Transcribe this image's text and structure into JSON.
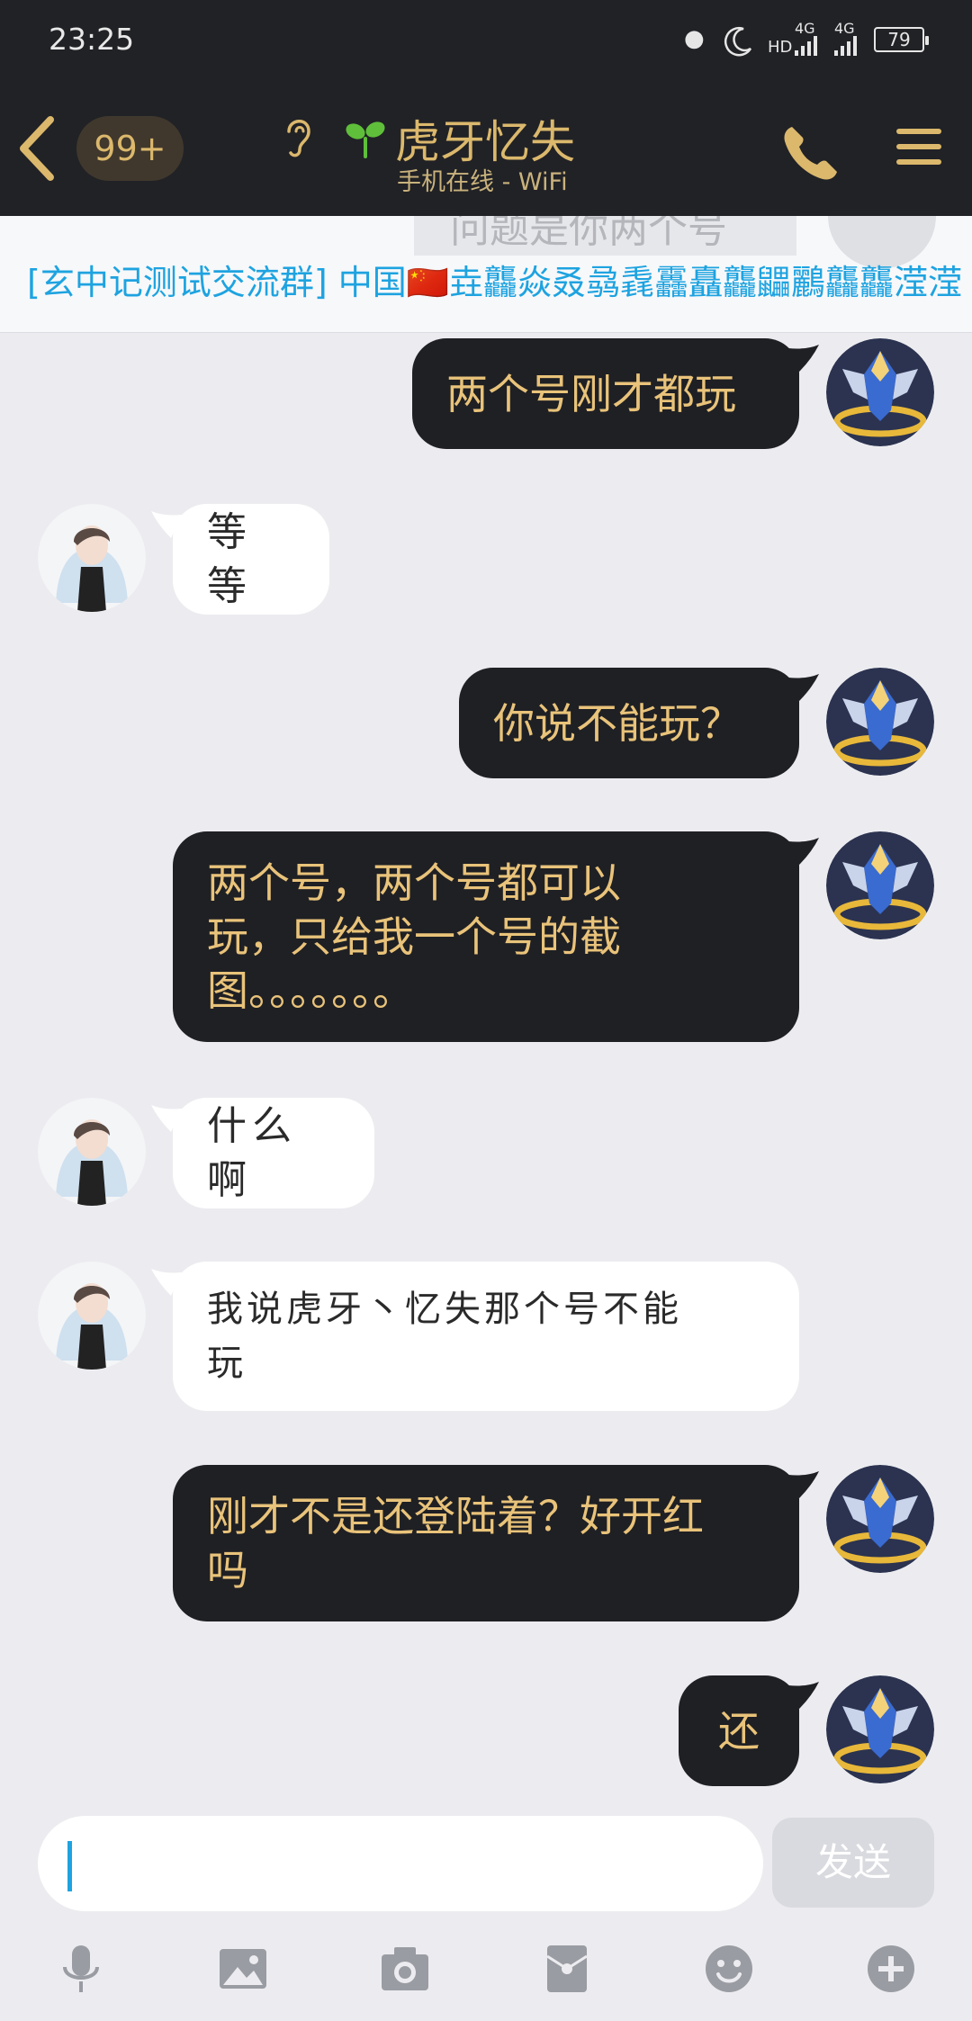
{
  "status_bar": {
    "time": "23:25",
    "network_1": "4G",
    "network_2": "4G",
    "hd": "HD",
    "battery": "79"
  },
  "header": {
    "unread_count": "99+",
    "contact_name": "虎牙忆失",
    "contact_status": "手机在线 - WiFi"
  },
  "ticker": {
    "background_text": "问题是你两个号",
    "text": "[玄中记测试交流群] 中国🇨🇳垚龘焱叒骉毳靐矗龘鼺鸝龘龘滢滢"
  },
  "messages": [
    {
      "side": "me",
      "text": "两个号刚才都玩"
    },
    {
      "side": "other",
      "text": "等等"
    },
    {
      "side": "me",
      "text": "你说不能玩？"
    },
    {
      "side": "me",
      "line1": "两个号，两个号都可以",
      "line2": "玩，只给我一个号的截",
      "line3": "图。。。。。。。"
    },
    {
      "side": "other",
      "text": "什么啊"
    },
    {
      "side": "other",
      "line1": "我说虎牙丶忆失那个号不能",
      "line2": "玩"
    },
    {
      "side": "me",
      "line1": "刚才不是还登陆着？好开红",
      "line2": "吗"
    },
    {
      "side": "me",
      "text": "还"
    }
  ],
  "input": {
    "send_label": "发送"
  },
  "toolbar": [
    "mic-icon",
    "image-icon",
    "camera-icon",
    "red-packet-icon",
    "emoji-icon",
    "plus-icon"
  ],
  "colors": {
    "header_bg": "#212226",
    "accent_gold": "#dbb86c",
    "my_bubble_bg": "#1f2024",
    "my_bubble_text": "#e9c37a",
    "link_blue": "#1ea3e0",
    "chat_bg": "#ececf0"
  }
}
